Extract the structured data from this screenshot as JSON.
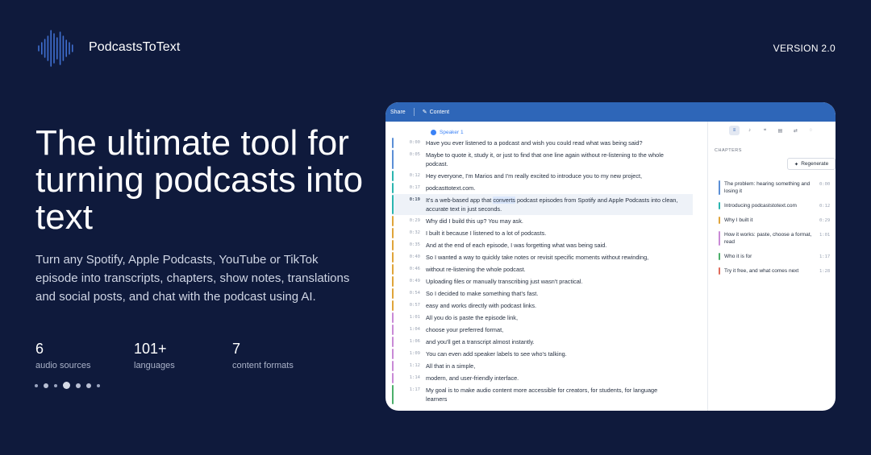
{
  "header": {
    "brand": "PodcastsToText",
    "version": "VERSION 2.0",
    "logo_icon": "waveform-icon"
  },
  "hero": {
    "title": "The ultimate tool for turning podcasts into text",
    "subtitle": "Turn any Spotify, Apple Podcasts, YouTube or TikTok episode into transcripts, chapters, show notes, translations and social posts, and chat with the podcast using AI."
  },
  "stats": [
    {
      "value": "6",
      "label": "audio sources"
    },
    {
      "value": "101+",
      "label": "languages"
    },
    {
      "value": "7",
      "label": "content formats"
    }
  ],
  "colors": {
    "background": "#0f1a3c",
    "app_bar": "#2e66b8",
    "accent": "#3b82f6"
  },
  "app": {
    "toolbar": {
      "share": "Share",
      "content": "Content"
    },
    "speaker": "Speaker 1",
    "transcript": [
      {
        "ts": "0:00",
        "text": "Have you ever listened to a podcast and wish you could read what was being said?",
        "color": "#5b8fd6"
      },
      {
        "ts": "0:05",
        "text": "Maybe to quote it, study it, or just to find that one line again without re-listening to the whole podcast.",
        "color": "#5b8fd6"
      },
      {
        "ts": "0:12",
        "text": "Hey everyone, I'm Marios and I'm really excited to introduce you to my new project,",
        "color": "#2bb5b0"
      },
      {
        "ts": "0:17",
        "text": "podcasttotext.com.",
        "color": "#2bb5b0"
      },
      {
        "ts": "0:19",
        "text_pre": "It's a web-based app that ",
        "text_hl": "converts",
        "text_post": " podcast episodes from Spotify and Apple Podcasts into clean, accurate text in just seconds.",
        "color": "#2bb5b0",
        "active": true
      },
      {
        "ts": "0:29",
        "text": "Why did I build this up? You may ask.",
        "color": "#e0a43a"
      },
      {
        "ts": "0:32",
        "text": "I built it because I listened to a lot of podcasts.",
        "color": "#e0a43a"
      },
      {
        "ts": "0:35",
        "text": "And at the end of each episode, I was forgetting what was being said.",
        "color": "#e0a43a"
      },
      {
        "ts": "0:40",
        "text": "So I wanted a way to quickly take notes or revisit specific moments without rewinding,",
        "color": "#e0a43a"
      },
      {
        "ts": "0:46",
        "text": "without re-listening the whole podcast.",
        "color": "#e0a43a"
      },
      {
        "ts": "0:49",
        "text": "Uploading files or manually transcribing just wasn't practical.",
        "color": "#e0a43a"
      },
      {
        "ts": "0:54",
        "text": "So I decided to make something that's fast.",
        "color": "#e0a43a"
      },
      {
        "ts": "0:57",
        "text": "easy and works directly with podcast links.",
        "color": "#e0a43a"
      },
      {
        "ts": "1:01",
        "text": "All you do is paste the episode link,",
        "color": "#c98ad6"
      },
      {
        "ts": "1:04",
        "text": "choose your preferred format,",
        "color": "#c98ad6"
      },
      {
        "ts": "1:06",
        "text": "and you'll get a transcript almost instantly.",
        "color": "#c98ad6"
      },
      {
        "ts": "1:09",
        "text": "You can even add speaker labels to see who's talking.",
        "color": "#c98ad6"
      },
      {
        "ts": "1:12",
        "text": "All that in a simple,",
        "color": "#c98ad6"
      },
      {
        "ts": "1:14",
        "text": "modern, and user-friendly interface.",
        "color": "#c98ad6"
      },
      {
        "ts": "1:17",
        "text": "My goal is to make audio content more accessible for creators, for students, for language learners",
        "color": "#4caf6a"
      }
    ],
    "chapters_title": "CHAPTERS",
    "regenerate_label": "Regenerate",
    "chapters": [
      {
        "title": "The problem: hearing something and losing it",
        "ts": "0:00",
        "color": "#5b8fd6"
      },
      {
        "title": "Introducing podcaststotext.com",
        "ts": "0:12",
        "color": "#2bb5b0"
      },
      {
        "title": "Why I built it",
        "ts": "0:29",
        "color": "#e0a43a"
      },
      {
        "title": "How it works: paste, choose a format, read",
        "ts": "1:01",
        "color": "#c98ad6"
      },
      {
        "title": "Who it is for",
        "ts": "1:17",
        "color": "#4caf6a"
      },
      {
        "title": "Try it free, and what comes next",
        "ts": "1:28",
        "color": "#e06a5a"
      }
    ]
  }
}
